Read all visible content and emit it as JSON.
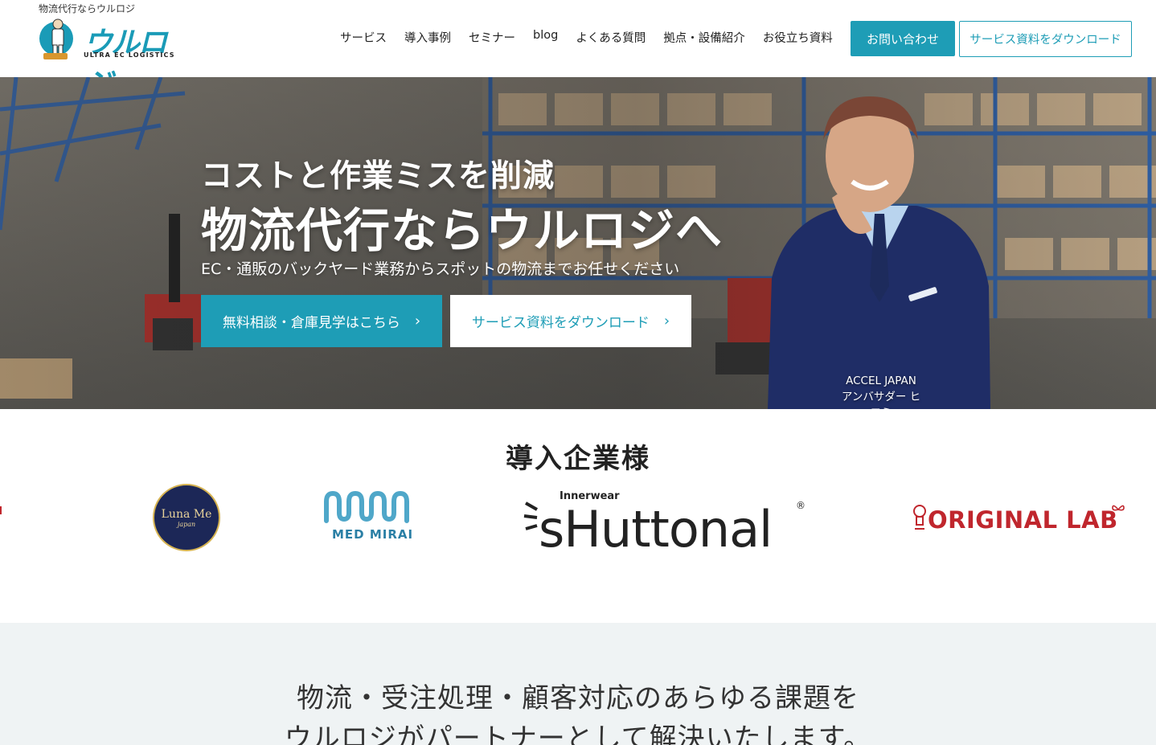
{
  "header": {
    "tagline": "物流代行ならウルロジ",
    "logo_text": "ウルロジ",
    "logo_sub": "ULTRA EC LOGISTICS",
    "nav": [
      "サービス",
      "導入事例",
      "セミナー",
      "blog",
      "よくある質問",
      "拠点・設備紹介",
      "お役立ち資料"
    ],
    "contact_label": "お問い合わせ",
    "download_label": "サービス資料をダウンロード"
  },
  "hero": {
    "headline1": "コストと作業ミスを削減",
    "headline2": "物流代行ならウルロジへ",
    "subtext": "EC・通販のバックヤード業務からスポットの物流までお任せください",
    "cta_primary": "無料相談・倉庫見学はこちら",
    "cta_secondary": "サービス資料をダウンロード",
    "ambassador_line1": "ACCEL JAPAN",
    "ambassador_line2": "アンバサダー ヒロミ"
  },
  "clients": {
    "title": "導入企業様",
    "logos": {
      "luna_name": "Luna Me",
      "luna_sub": "japan",
      "medmirai": "MED MIRAI",
      "shuttonal_top": "Innerwear",
      "shuttonal_main": "sHuttonal",
      "shuttonal_reg": "®",
      "original_lab": "ORIGINAL LAB"
    }
  },
  "problem": {
    "line1": "物流・受注処理・顧客対応のあらゆる課題を",
    "line2": "ウルロジがパートナーとして解決いたします。"
  },
  "icons": {
    "cta_chevron": "chevron-right-icon"
  },
  "colors": {
    "accent": "#1e9db6",
    "dark_navy": "#1c2757",
    "brand_red": "#c0262d",
    "problem_bg": "#eff3f4"
  }
}
